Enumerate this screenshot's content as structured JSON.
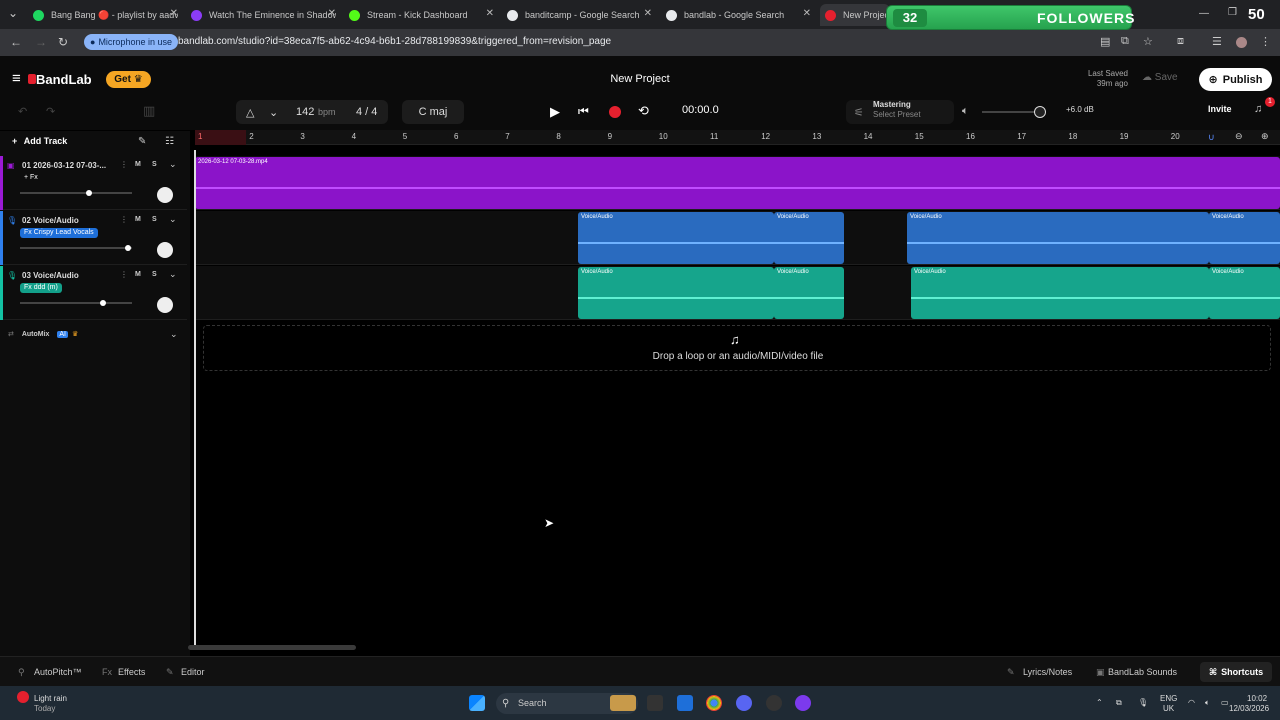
{
  "browser": {
    "tabs": [
      {
        "title": "Bang Bang 🔴 - playlist by aadv",
        "color": "#1ed760"
      },
      {
        "title": "Watch The Eminence in Shadow",
        "color": "#8b3cf7"
      },
      {
        "title": "Stream - Kick Dashboard",
        "color": "#53fc18"
      },
      {
        "title": "banditcamp - Google Search",
        "color": "#e8eaed"
      },
      {
        "title": "bandlab - Google Search",
        "color": "#e8eaed"
      },
      {
        "title": "New Project",
        "color": "#e5202e"
      }
    ],
    "mic_label": "Microphone in use",
    "url": "bandlab.com/studio?id=38eca7f5-ab62-4c94-b6b1-28d788199839&triggered_from=revision_page"
  },
  "overlay": {
    "followers_count": "32",
    "followers_label": "FOLLOWERS",
    "right_number": "50"
  },
  "header": {
    "brand": "BandLab",
    "get_label": "Get",
    "project_title": "New Project",
    "last_saved_label": "Last Saved",
    "last_saved_time": "39m ago",
    "save_label": "Save",
    "publish_label": "Publish"
  },
  "transport": {
    "bpm": "142",
    "bpm_unit": "bpm",
    "time_sig": "4 / 4",
    "key": "C maj",
    "time": "00:00.0",
    "mastering_label": "Mastering",
    "mastering_preset": "Select Preset",
    "gain": "+6.0 dB",
    "invite_label": "Invite",
    "notif_count": "1"
  },
  "tracks_panel": {
    "add_track_label": "Add Track",
    "automix_label": "AutoMix",
    "ai_badge": "AI"
  },
  "ruler": {
    "bars": [
      "1",
      "2",
      "3",
      "4",
      "5",
      "6",
      "7",
      "8",
      "9",
      "10",
      "11",
      "12",
      "13",
      "14",
      "15",
      "16",
      "17",
      "18",
      "19",
      "20"
    ]
  },
  "tracks": [
    {
      "name": "01  2026-03-12 07-03-...",
      "fx": "+ Fx",
      "color": "#9b1ad6",
      "clips": [
        {
          "label": "2026-03-12 07-03-28.mp4"
        }
      ],
      "volume": 0.62
    },
    {
      "name": "02  Voice/Audio",
      "fx": "Fx  Crispy Lead Vocals",
      "color": "#2f80ed",
      "clips": [
        {
          "label": "Voice/Audio"
        },
        {
          "label": "Voice/Audio"
        },
        {
          "label": "Voice/Audio"
        },
        {
          "label": "Voice/Audio"
        }
      ],
      "volume": 0.96
    },
    {
      "name": "03  Voice/Audio",
      "fx": "Fx  ddd (m)",
      "color": "#13c2a3",
      "clips": [
        {
          "label": "Voice/Audio"
        },
        {
          "label": "Voice/Audio"
        },
        {
          "label": "Voice/Audio"
        },
        {
          "label": "Voice/Audio"
        }
      ],
      "volume": 0.74
    }
  ],
  "track_buttons": {
    "mute": "M",
    "solo": "S"
  },
  "dropzone": {
    "text": "Drop a loop or an audio/MIDI/video file"
  },
  "bottombar": {
    "autopitch": "AutoPitch™",
    "effects": "Effects",
    "editor": "Editor",
    "lyrics": "Lyrics/Notes",
    "sounds": "BandLab Sounds",
    "shortcuts": "Shortcuts"
  },
  "taskbar": {
    "weather": "Light rain",
    "weather_sub": "Today",
    "search": "Search",
    "lang": "ENG",
    "region": "UK",
    "time": "10:02",
    "date": "12/03/2026"
  }
}
